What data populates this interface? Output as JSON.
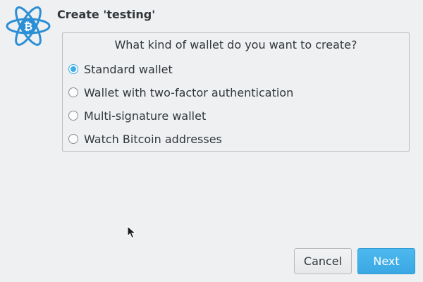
{
  "dialog": {
    "title": "Create 'testing'",
    "question": "What kind of wallet do you want to create?"
  },
  "options": [
    {
      "label": "Standard wallet",
      "checked": true
    },
    {
      "label": "Wallet with two-factor authentication",
      "checked": false
    },
    {
      "label": "Multi-signature wallet",
      "checked": false
    },
    {
      "label": "Watch Bitcoin addresses",
      "checked": false
    }
  ],
  "buttons": {
    "cancel_label": "Cancel",
    "next_label": "Next"
  },
  "icons": {
    "logo": "electrum-logo-icon",
    "cursor": "mouse-pointer-icon"
  },
  "colors": {
    "accent": "#3daee9",
    "logo": "#2b8fd6",
    "background": "#eff0f1"
  }
}
